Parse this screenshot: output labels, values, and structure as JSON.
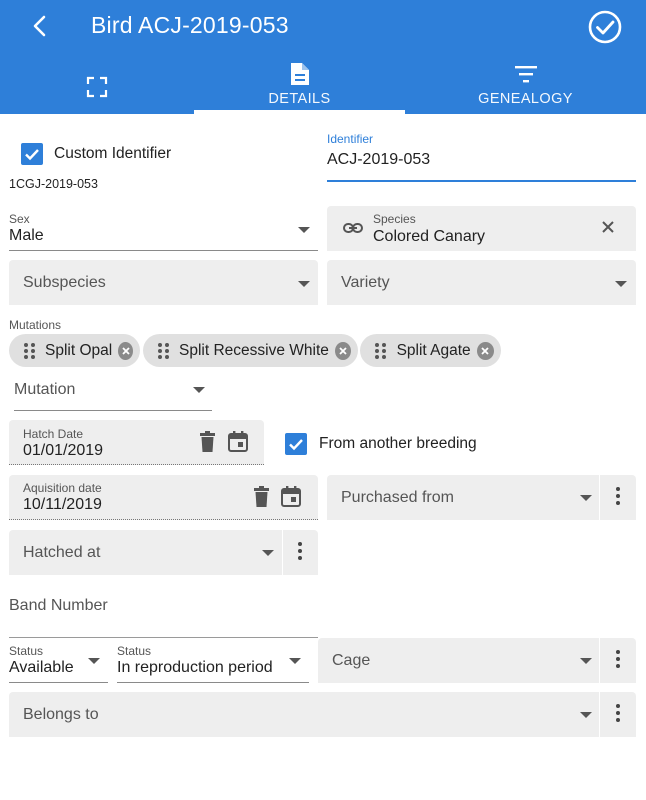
{
  "header": {
    "title": "Bird ACJ-2019-053",
    "tabs": [
      {
        "label": "",
        "icon": "fullscreen-icon"
      },
      {
        "label": "DETAILS",
        "icon": "document-icon"
      },
      {
        "label": "GENEALOGY",
        "icon": "filter-icon"
      }
    ],
    "active_tab": "DETAILS",
    "colors": {
      "primary": "#2e7fd9",
      "tab_indicator": "#ffffff"
    }
  },
  "form": {
    "custom_identifier": {
      "label": "Custom Identifier",
      "checked": true
    },
    "generated_id": "1CGJ-2019-053",
    "identifier": {
      "label": "Identifier",
      "value": "ACJ-2019-053"
    },
    "sex": {
      "label": "Sex",
      "value": "Male"
    },
    "species": {
      "label": "Species",
      "value": "Colored Canary"
    },
    "subspecies": {
      "placeholder": "Subspecies"
    },
    "variety": {
      "placeholder": "Variety"
    },
    "mutations": {
      "label": "Mutations",
      "chips": [
        "Split Opal",
        "Split Recessive White",
        "Split Agate"
      ],
      "select_placeholder": "Mutation"
    },
    "hatch_date": {
      "label": "Hatch Date",
      "value": "01/01/2019"
    },
    "from_another_breeding": {
      "label": "From another breeding",
      "checked": true
    },
    "acquisition_date": {
      "label": "Aquisition date",
      "value": "10/11/2019"
    },
    "purchased_from": {
      "placeholder": "Purchased from"
    },
    "hatched_at": {
      "placeholder": "Hatched at"
    },
    "band_number": {
      "placeholder": "Band Number"
    },
    "status": {
      "label": "Status",
      "value": "Available"
    },
    "status2": {
      "label": "Status",
      "value": "In reproduction period"
    },
    "cage": {
      "placeholder": "Cage"
    },
    "belongs_to": {
      "placeholder": "Belongs to"
    }
  }
}
